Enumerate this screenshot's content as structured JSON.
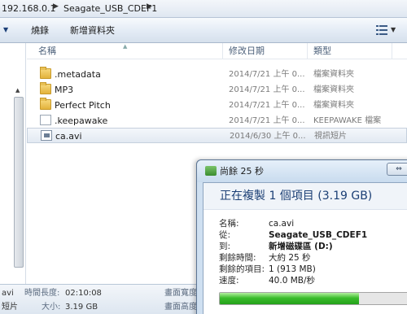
{
  "address": {
    "crumb_host": "192.168.0.1",
    "crumb_share": "Seagate_USB_CDEF1"
  },
  "toolbar": {
    "burn_label": "燒錄",
    "new_folder_label": "新增資料夾"
  },
  "columns": {
    "name": "名稱",
    "modified": "修改日期",
    "type": "類型"
  },
  "files": [
    {
      "name": ".metadata",
      "modified": "2014/7/21 上午 0...",
      "type": "檔案資料夾",
      "icon": "folder-icon"
    },
    {
      "name": "MP3",
      "modified": "2014/7/21 上午 0...",
      "type": "檔案資料夾",
      "icon": "folder-icon"
    },
    {
      "name": "Perfect Pitch",
      "modified": "2014/7/21 上午 0...",
      "type": "檔案資料夾",
      "icon": "folder-icon"
    },
    {
      "name": ".keepawake",
      "modified": "2014/7/21 上午 0...",
      "type": "KEEPAWAKE 檔案",
      "icon": "file-icon"
    },
    {
      "name": "ca.avi",
      "modified": "2014/6/30 上午 0...",
      "type": "視訊短片",
      "icon": "video-file-icon"
    }
  ],
  "details": {
    "file_name": "avi",
    "kind": "短片",
    "length_label": "時間長度:",
    "length_value": "02:10:08",
    "size_label": "大小:",
    "size_value": "3.19 GB",
    "frame_width_label": "畫面寬度",
    "frame_height_label": "畫面高度"
  },
  "dialog": {
    "title": "尚餘 25 秒",
    "heading": "正在複製 1 個項目 (3.19 GB)",
    "name_label": "名稱:",
    "name_value": "ca.avi",
    "from_label": "從:",
    "from_value": "Seagate_USB_CDEF1",
    "to_label": "到:",
    "to_value": "新增磁碟區 (D:)",
    "time_left_label": "剩餘時間:",
    "time_left_value": "大約 25 秒",
    "items_left_label": "剩餘的項目:",
    "items_left_value": "1 (913 MB)",
    "speed_label": "速度:",
    "speed_value": "40.0 MB/秒",
    "progress_percent": 72,
    "progress_color": "#3bbd2c"
  }
}
